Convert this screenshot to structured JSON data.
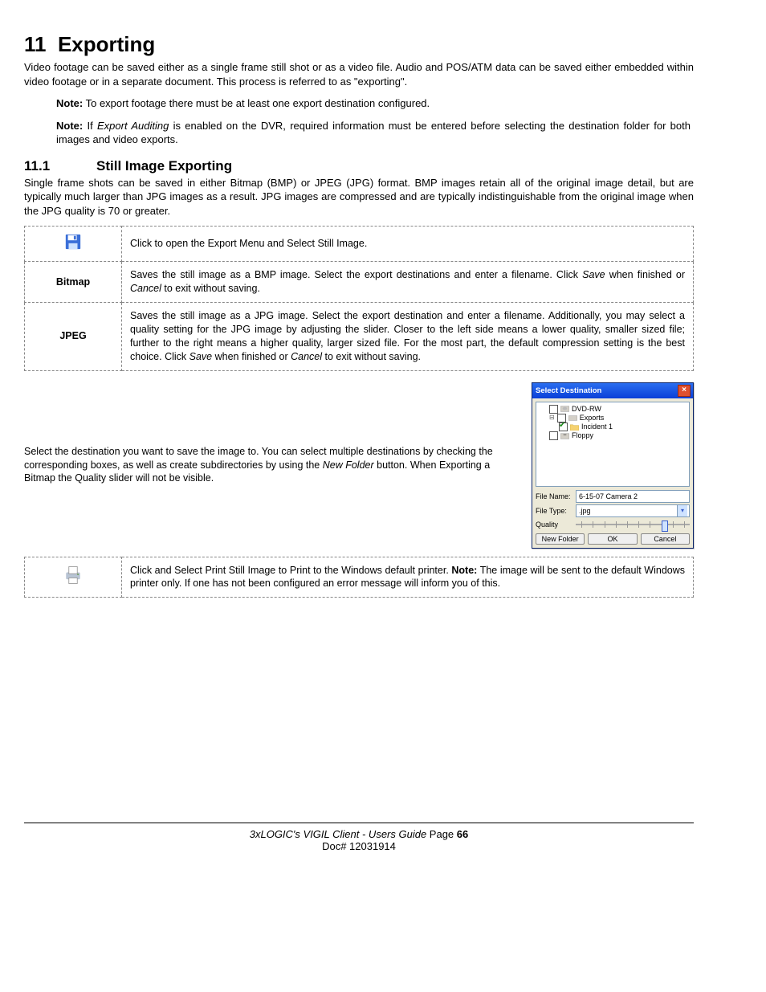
{
  "heading": {
    "number": "11",
    "title": "Exporting"
  },
  "intro": "Video footage can be saved either as a single frame still shot or as a video file.  Audio and POS/ATM data can be saved either embedded within video footage or in a separate document. This process is referred to as \"exporting\".",
  "note1_label": "Note:",
  "note1_text": " To export footage there must be at least one export destination configured.",
  "note2_label": "Note:",
  "note2_pre": " If ",
  "note2_em": "Export Auditing",
  "note2_post": " is enabled on the DVR, required information must be entered before selecting the destination folder for both images and video exports.",
  "sub": {
    "number": "11.1",
    "title": "Still Image Exporting"
  },
  "sub_intro": "Single frame shots can be saved in either Bitmap (BMP) or JPEG (JPG) format. BMP images retain all of the original image detail, but are typically much larger than JPG images as a result. JPG images are compressed and are typically indistinguishable from the original image when the JPG quality is 70 or greater.",
  "row_disk": "Click to open the Export Menu and Select Still Image.",
  "row_bitmap_label": "Bitmap",
  "row_bitmap_a": "Saves the still image as a BMP image. Select the export destinations and enter a filename. Click ",
  "row_bitmap_save": "Save",
  "row_bitmap_b": " when finished or ",
  "row_bitmap_cancel": "Cancel",
  "row_bitmap_c": " to exit without saving.",
  "row_jpeg_label": "JPEG",
  "row_jpeg_a": "Saves the still image as a JPG image. Select the export destination and enter a filename. Additionally, you may select a quality setting for the JPG image by adjusting the slider. Closer to the left side means a lower quality, smaller sized file; further to the right means a higher quality, larger sized file. For the most part, the default compression setting is the best choice. Click ",
  "row_jpeg_save": "Save",
  "row_jpeg_b": " when finished or ",
  "row_jpeg_cancel": "Cancel",
  "row_jpeg_c": " to exit without saving.",
  "dest_a": "Select the destination you want to save the image to. You can select multiple destinations by checking the corresponding boxes, as well as create subdirectories by using the ",
  "dest_em": "New Folder",
  "dest_b": " button.  When Exporting a Bitmap the Quality slider will not be visible.",
  "dialog": {
    "title": "Select Destination",
    "tree": {
      "dvdrw": "DVD-RW",
      "exports": "Exports",
      "incident1": "Incident 1",
      "floppy": "Floppy"
    },
    "file_name_label": "File Name:",
    "file_name_value": "6-15-07 Camera 2",
    "file_type_label": "File Type:",
    "file_type_value": ".jpg",
    "quality_label": "Quality",
    "btn_new_folder": "New Folder",
    "btn_ok": "OK",
    "btn_cancel": "Cancel"
  },
  "row_print_a": "Click and Select Print Still Image to Print to the Windows default printer.  ",
  "row_print_note_label": "Note:",
  "row_print_b": " The image will be sent to the default Windows printer only. If one has not been configured an error message will inform you of this.",
  "footer": {
    "product_em": "3xLOGIC's VIGIL Client - Users Guide",
    "page_word": " Page ",
    "page_num": "66",
    "doc": "Doc# 12031914"
  }
}
